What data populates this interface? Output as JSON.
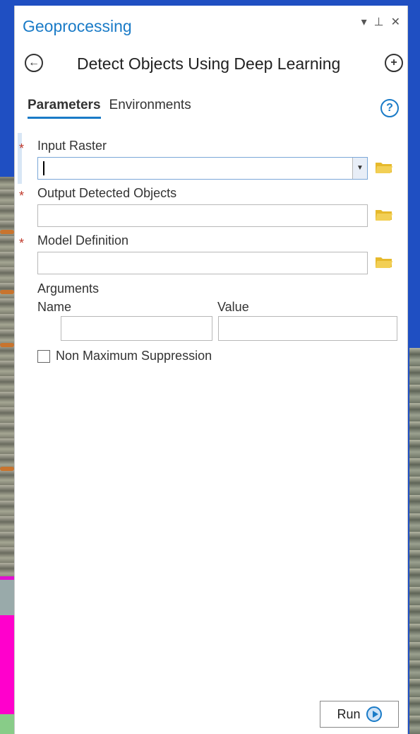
{
  "panel": {
    "title": "Geoprocessing",
    "tools": {
      "menu": "▾",
      "pin": "⊥",
      "close": "✕"
    }
  },
  "tool": {
    "back_icon": "←",
    "title": "Detect Objects Using Deep Learning",
    "add_icon": "+"
  },
  "tabs": [
    {
      "label": "Parameters",
      "active": true
    },
    {
      "label": "Environments",
      "active": false
    }
  ],
  "help_icon": "?",
  "params": {
    "input_raster": {
      "label": "Input Raster",
      "required": "*",
      "value": ""
    },
    "output_objects": {
      "label": "Output Detected Objects",
      "required": "*",
      "value": ""
    },
    "model_definition": {
      "label": "Model Definition",
      "required": "*",
      "value": ""
    },
    "arguments": {
      "label": "Arguments",
      "name_header": "Name",
      "value_header": "Value"
    },
    "nms": {
      "label": "Non Maximum Suppression",
      "checked": false
    }
  },
  "run": {
    "label": "Run"
  },
  "colors": {
    "accent": "#1a7bc7",
    "required": "#c0392b",
    "folder": "#e6b92c"
  }
}
